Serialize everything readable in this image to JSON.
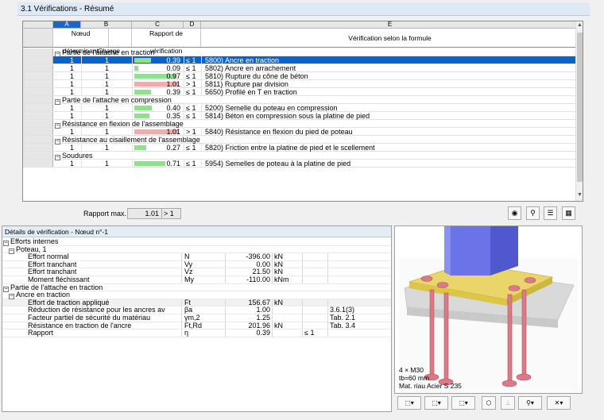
{
  "window": {
    "title": "3.1 Vérifications - Résumé"
  },
  "grid": {
    "col_letters": [
      "A",
      "B",
      "C",
      "D",
      "E"
    ],
    "headers": {
      "a": [
        "Nœud",
        "déterminant"
      ],
      "b": [
        "",
        "Charge"
      ],
      "cd": [
        "Rapport de",
        "vérification"
      ],
      "e": "Vérification selon la formule"
    },
    "sections": [
      {
        "title": "Partie de l'attache en traction",
        "rows": [
          {
            "node": "1",
            "load": "1",
            "ratio": "0.39",
            "op": "≤ 1",
            "color": "#8fe08f",
            "fill": 0.39,
            "formula": "5800) Ancre en traction",
            "selected": true
          },
          {
            "node": "1",
            "load": "1",
            "ratio": "0.09",
            "op": "≤ 1",
            "color": "#8fe08f",
            "fill": 0.09,
            "formula": "5802) Ancre en arrachement"
          },
          {
            "node": "1",
            "load": "1",
            "ratio": "0.97",
            "op": "≤ 1",
            "color": "#8fe08f",
            "fill": 0.97,
            "formula": "5810) Rupture du cône de béton"
          },
          {
            "node": "1",
            "load": "1",
            "ratio": "1.01",
            "op": "> 1",
            "color": "#f4aaaa",
            "fill": 1.0,
            "formula": "5811) Rupture par division"
          },
          {
            "node": "1",
            "load": "1",
            "ratio": "0.39",
            "op": "≤ 1",
            "color": "#8fe08f",
            "fill": 0.39,
            "formula": "5650) Profilé en T en traction"
          }
        ]
      },
      {
        "title": "Partie de l'attache en compression",
        "rows": [
          {
            "node": "1",
            "load": "1",
            "ratio": "0.40",
            "op": "≤ 1",
            "color": "#8fe08f",
            "fill": 0.4,
            "formula": "5200) Semelle du poteau en compression"
          },
          {
            "node": "1",
            "load": "1",
            "ratio": "0.35",
            "op": "≤ 1",
            "color": "#8fe08f",
            "fill": 0.35,
            "formula": "5814) Béton en compression sous la platine de pied"
          }
        ]
      },
      {
        "title": "Résistance en flexion de l'assemblage",
        "rows": [
          {
            "node": "1",
            "load": "1",
            "ratio": "1.01",
            "op": "> 1",
            "color": "#f4aaaa",
            "fill": 1.0,
            "formula": "5840) Résistance en flexion du pied de poteau"
          }
        ]
      },
      {
        "title": "Résistance au cisaillement de l'assemblage",
        "rows": [
          {
            "node": "1",
            "load": "1",
            "ratio": "0.27",
            "op": "≤ 1",
            "color": "#8fe08f",
            "fill": 0.27,
            "formula": "5820) Friction entre la platine de pied et le scellement"
          }
        ]
      },
      {
        "title": "Soudures",
        "rows": [
          {
            "node": "1",
            "load": "1",
            "ratio": "0.71",
            "op": "≤ 1",
            "color": "#8fe08f",
            "fill": 0.71,
            "formula": "5954) Semelles de poteau à la platine de pied"
          }
        ]
      }
    ]
  },
  "summary": {
    "label": "Rapport max. :",
    "value": "1.01",
    "op": "> 1"
  },
  "details": {
    "title": "Détails de vérification - Nœud n°-1",
    "rows": [
      {
        "kind": "g0",
        "name": "Efforts internes"
      },
      {
        "kind": "g1",
        "name": "Poteau, 1"
      },
      {
        "kind": "v",
        "name": "Effort normal",
        "sym": "N",
        "val": "-396.00",
        "unit": "kN",
        "op": "",
        "ref": ""
      },
      {
        "kind": "v",
        "name": "Effort tranchant",
        "sym": "Vy",
        "val": "0.00",
        "unit": "kN",
        "op": "",
        "ref": ""
      },
      {
        "kind": "v",
        "name": "Effort tranchant",
        "sym": "Vz",
        "val": "21.50",
        "unit": "kN",
        "op": "",
        "ref": ""
      },
      {
        "kind": "v",
        "name": "Moment fléchissant",
        "sym": "My",
        "val": "-110.00",
        "unit": "kNm",
        "op": "",
        "ref": ""
      },
      {
        "kind": "g0",
        "name": "Partie de l'attache en traction"
      },
      {
        "kind": "g1",
        "name": "Ancre en traction"
      },
      {
        "kind": "v",
        "name": "Effort de traction appliqué",
        "sym": "Ft",
        "val": "156.67",
        "unit": "kN",
        "op": "",
        "ref": "",
        "shade": true
      },
      {
        "kind": "v",
        "name": "Réduction de résistance pour les ancres av",
        "sym": "βa",
        "val": "1.00",
        "unit": "",
        "op": "",
        "ref": "3.6.1(3)"
      },
      {
        "kind": "v",
        "name": "Facteur partiel de sécurité du matériau",
        "sym": "γm,2",
        "val": "1.25",
        "unit": "",
        "op": "",
        "ref": "Tab. 2.1"
      },
      {
        "kind": "v",
        "name": "Résistance en traction de l'ancre",
        "sym": "Ft,Rd",
        "val": "201.96",
        "unit": "kN",
        "op": "",
        "ref": "Tab. 3.4"
      },
      {
        "kind": "v",
        "name": "Rapport",
        "sym": "η",
        "val": "0.39",
        "unit": "",
        "op": "≤ 1",
        "ref": ""
      }
    ]
  },
  "viewer": {
    "lines": [
      "4 × M30",
      "tb=60 mm",
      "Mat. riau Acier S 235"
    ]
  },
  "colors": {
    "selection": "#0a64c8",
    "ok": "#8fe08f",
    "fail": "#f4aaaa",
    "column": "#6b73e8"
  }
}
